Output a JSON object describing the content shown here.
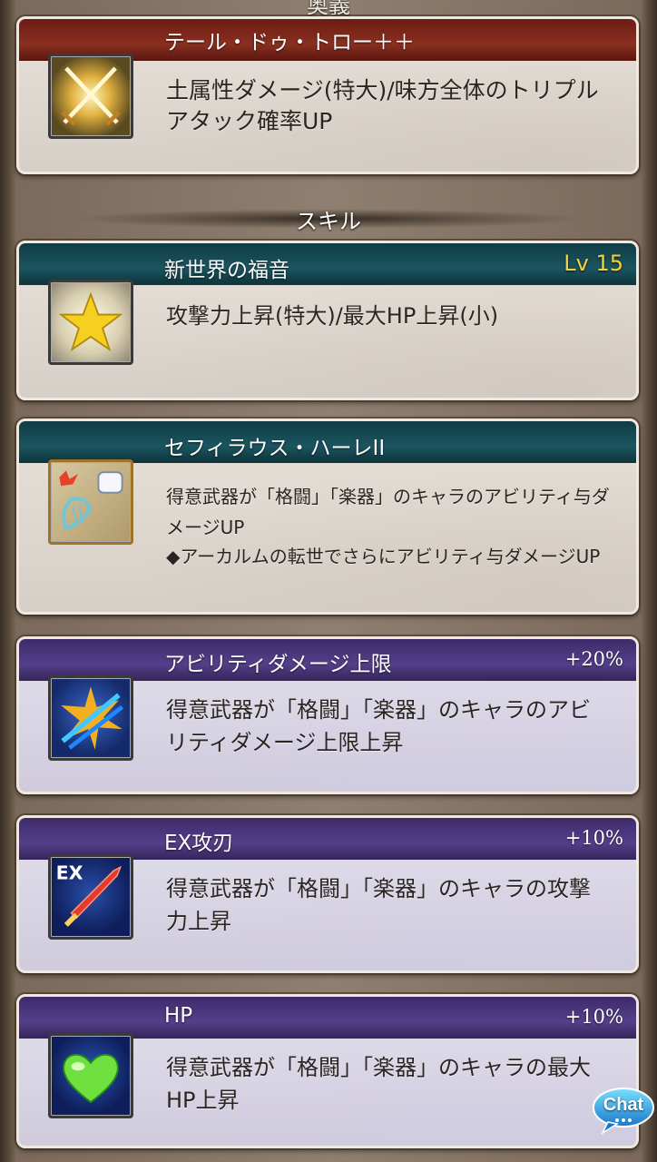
{
  "header_label": "奥義",
  "ougi": {
    "name": "テール・ドゥ・トロー＋＋",
    "desc": "土属性ダメージ(特大)/味方全体のトリプルアタック確率UP",
    "icon": "crossed-swords-icon"
  },
  "section_skills": "スキル",
  "skills": [
    {
      "name": "新世界の福音",
      "level": "Lv 15",
      "desc": "攻撃力上昇(特大)/最大HP上昇(小)",
      "icon": "star-icon"
    },
    {
      "name": "セフィラウス・ハーレII",
      "desc_line1": "得意武器が「格闘」「楽器」のキャラのアビリティ与ダメージUP",
      "desc_line2": "◆アーカルムの転世でさらにアビリティ与ダメージUP",
      "icon": "fist-harp-icon"
    }
  ],
  "emp": [
    {
      "name": "アビリティダメージ上限",
      "value": "+20%",
      "desc": "得意武器が「格闘」「楽器」のキャラのアビリティダメージ上限上昇",
      "icon": "ability-cap-icon"
    },
    {
      "name": "EX攻刃",
      "value": "+10%",
      "desc": "得意武器が「格闘」「楽器」のキャラの攻撃力上昇",
      "icon": "ex-sword-icon"
    },
    {
      "name": "HP",
      "value": "+10%",
      "desc": "得意武器が「格闘」「楽器」のキャラの最大HP上昇",
      "icon": "heart-icon"
    }
  ],
  "chat_button": "Chat",
  "colors": {
    "ougi_header": "#8a3020",
    "skill_header": "#1b5560",
    "emp_header": "#54408a",
    "level": "#f4d23a"
  }
}
